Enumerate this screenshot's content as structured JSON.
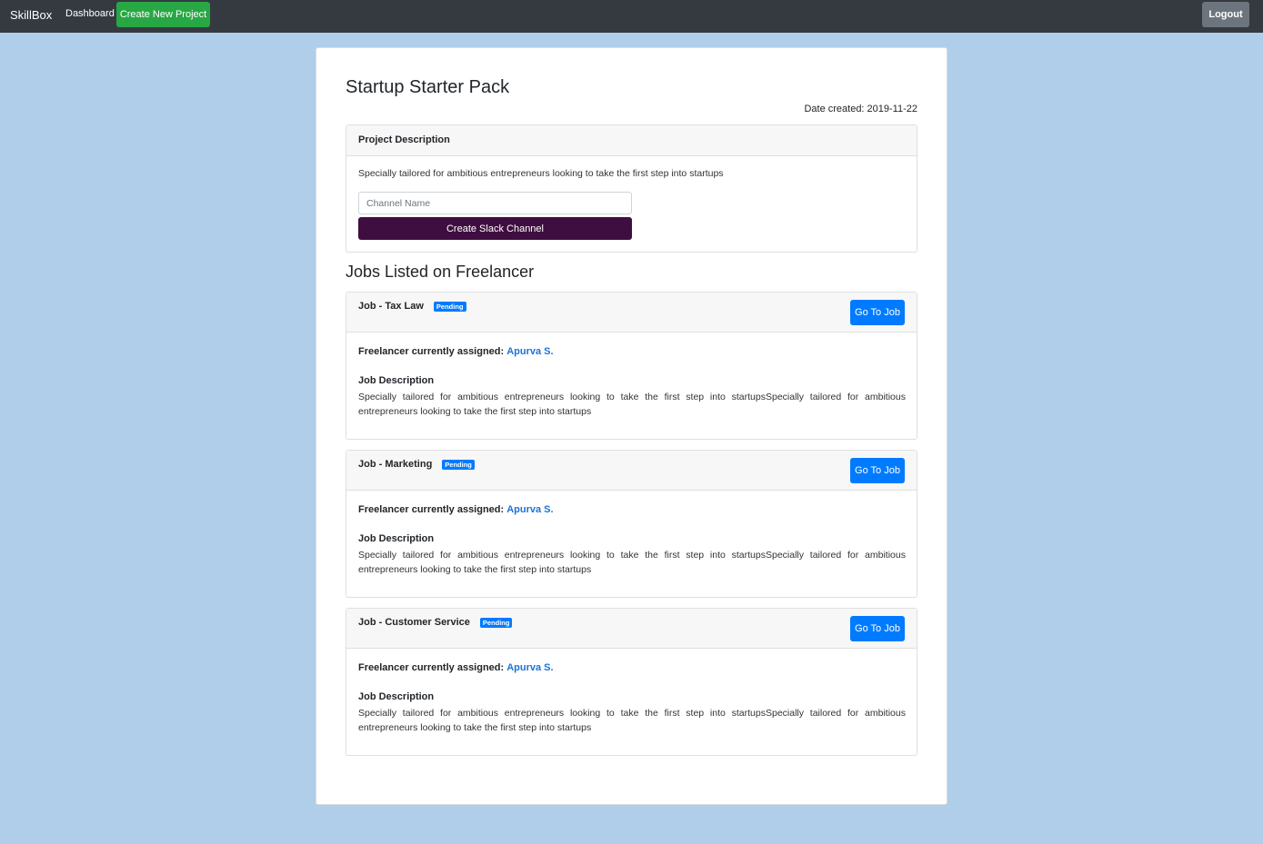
{
  "navbar": {
    "brand": "SkillBox",
    "dashboard_link": "Dashboard",
    "create_project_label": "Create New Project",
    "logout_label": "Logout"
  },
  "project": {
    "title": "Startup Starter Pack",
    "date_created": "Date created: 2019-11-22",
    "description_header": "Project Description",
    "description": "Specially tailored for ambitious entrepreneurs looking to take the first step into startups",
    "channel_placeholder": "Channel Name",
    "slack_button_label": "Create Slack Channel"
  },
  "jobs_heading": "Jobs Listed on Freelancer",
  "jobs": [
    {
      "title": "Job - Tax Law",
      "status": "Pending",
      "go_label": "Go To Job",
      "assigned_label": "Freelancer currently assigned:",
      "freelancer": "Apurva S.",
      "description_label": "Job Description",
      "description": "Specially tailored for ambitious entrepreneurs looking to take the first step into startupsSpecially tailored for ambitious entrepreneurs looking to take the first step into startups"
    },
    {
      "title": "Job - Marketing",
      "status": "Pending",
      "go_label": "Go To Job",
      "assigned_label": "Freelancer currently assigned:",
      "freelancer": "Apurva S.",
      "description_label": "Job Description",
      "description": "Specially tailored for ambitious entrepreneurs looking to take the first step into startupsSpecially tailored for ambitious entrepreneurs looking to take the first step into startups"
    },
    {
      "title": "Job - Customer Service",
      "status": "Pending",
      "go_label": "Go To Job",
      "assigned_label": "Freelancer currently assigned:",
      "freelancer": "Apurva S.",
      "description_label": "Job Description",
      "description": "Specially tailored for ambitious entrepreneurs looking to take the first step into startupsSpecially tailored for ambitious entrepreneurs looking to take the first step into startups"
    }
  ],
  "colors": {
    "navbar_bg": "#343a40",
    "page_bg": "#b0cde9",
    "success": "#28a745",
    "primary": "#007bff",
    "slack": "#3f0e40",
    "secondary": "#6c757d"
  }
}
